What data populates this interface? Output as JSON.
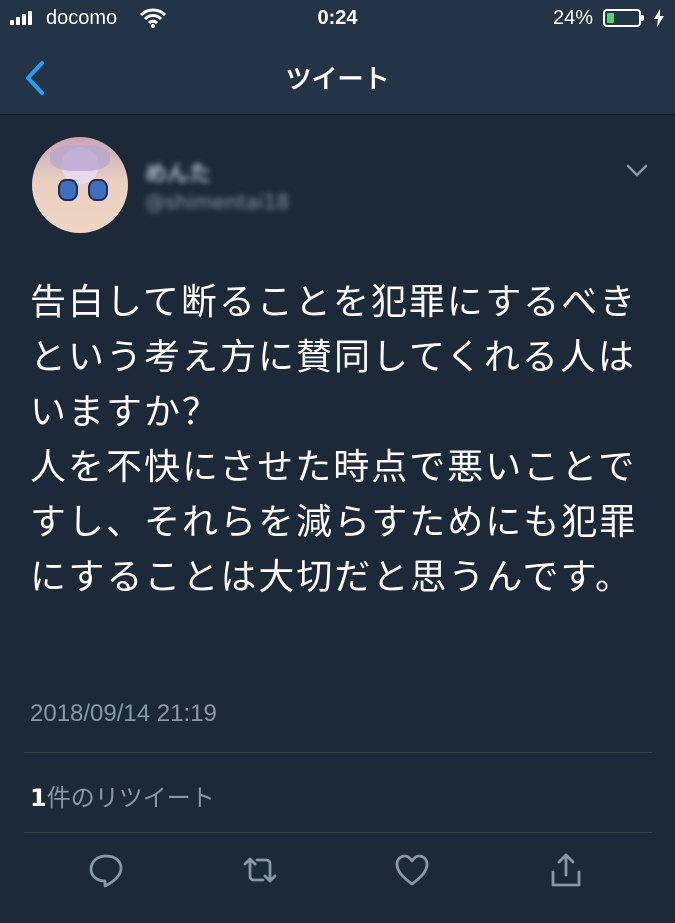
{
  "status_bar": {
    "carrier": "docomo",
    "time": "0:24",
    "battery_percent": "24%",
    "battery_level": 0.24,
    "icons": [
      "signal-icon",
      "wifi-icon",
      "battery-icon",
      "charging-icon"
    ]
  },
  "nav": {
    "title": "ツイート",
    "back_icon": "chevron-left-icon"
  },
  "tweet": {
    "author_name": "めんた",
    "author_handle": "@shimentai18",
    "text": "告白して断ることを犯罪にするべきという考え方に賛同してくれる人はいますか？\n人を不快にさせた時点で悪いことですし、それらを減らすためにも犯罪にすることは大切だと思うんです。",
    "timestamp": "2018/09/14 21:19",
    "retweet_count": "1",
    "retweet_label": "件のリツイート"
  },
  "actions": [
    "reply-icon",
    "retweet-icon",
    "like-icon",
    "share-icon"
  ],
  "colors": {
    "background": "#1c2938",
    "bar": "#243447",
    "accent": "#1da1f2",
    "muted": "#8899a6",
    "battery": "#4cd964"
  }
}
